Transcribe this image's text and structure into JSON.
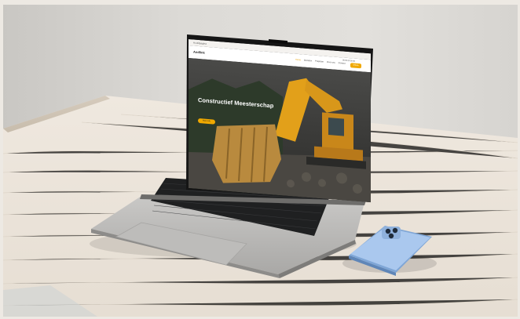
{
  "scene": {
    "description_free": true,
    "colors": {
      "wall": "#dcdad6",
      "table": "#e4ddd4",
      "laptop": "#b9b8b6",
      "screen_bezel": "#1c1c1c",
      "accent": "#f0a800",
      "phone": "#a9c6ea"
    }
  },
  "website": {
    "topbar_text": "Hoofdpagina",
    "brand": "Andlink",
    "nav_links": [
      "Home",
      "Diensten",
      "Projecten",
      "Over ons",
      "Contact"
    ],
    "phone_text": "06 00 00 00 00",
    "cta_label": "Offerte",
    "hero_title": "Constructief Meesterschap",
    "hero_button": "Meer info"
  }
}
